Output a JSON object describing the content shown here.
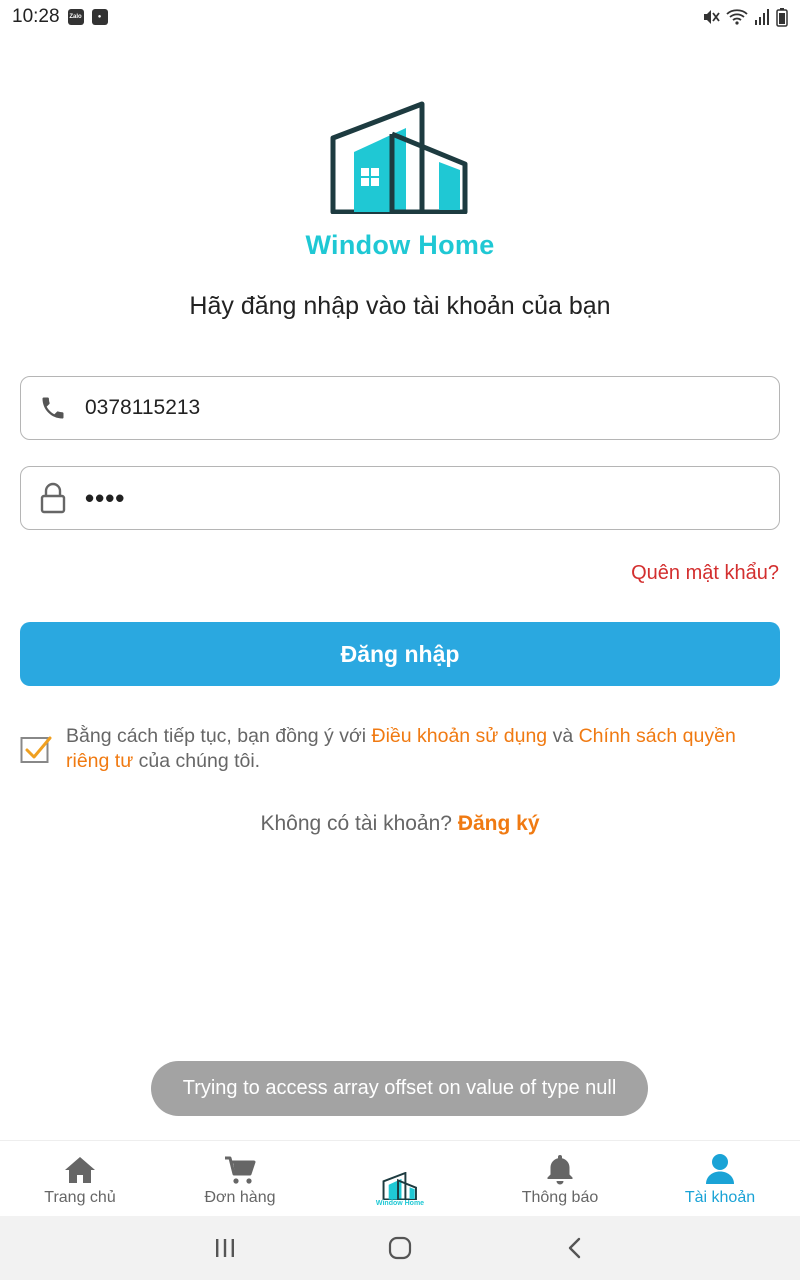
{
  "status_bar": {
    "time": "10:28",
    "app_badge": "Zalo"
  },
  "brand": {
    "name": "Window Home",
    "accent": "#1fc8d4",
    "outline": "#1d3b40"
  },
  "login": {
    "title": "Hãy đăng nhập vào tài khoản của bạn",
    "phone_value": "0378115213",
    "password_mask": "••••",
    "forgot_label": "Quên mật khẩu?",
    "submit_label": "Đăng nhập"
  },
  "terms": {
    "checked": true,
    "prefix": "Bằng cách tiếp tục, bạn đồng ý với ",
    "terms_link": "Điều khoản sử dụng",
    "middle": " và ",
    "privacy_link": "Chính sách quyền riêng tư",
    "suffix": " của chúng tôi."
  },
  "signup": {
    "prompt": "Không có tài khoản? ",
    "link": "Đăng ký"
  },
  "toast": {
    "message": "Trying to access array offset on value of type null"
  },
  "bottom_nav": {
    "items": [
      {
        "label": "Trang chủ",
        "icon": "home-icon"
      },
      {
        "label": "Đơn hàng",
        "icon": "cart-icon"
      },
      {
        "label": "Window Home",
        "icon": "window-home-logo"
      },
      {
        "label": "Thông báo",
        "icon": "bell-icon"
      },
      {
        "label": "Tài khoản",
        "icon": "user-icon",
        "active": true
      }
    ]
  },
  "colors": {
    "primary_button": "#2aa8e0",
    "link_orange": "#f07a12",
    "error_red": "#d32f2f",
    "active_tab": "#1aa3d6"
  }
}
